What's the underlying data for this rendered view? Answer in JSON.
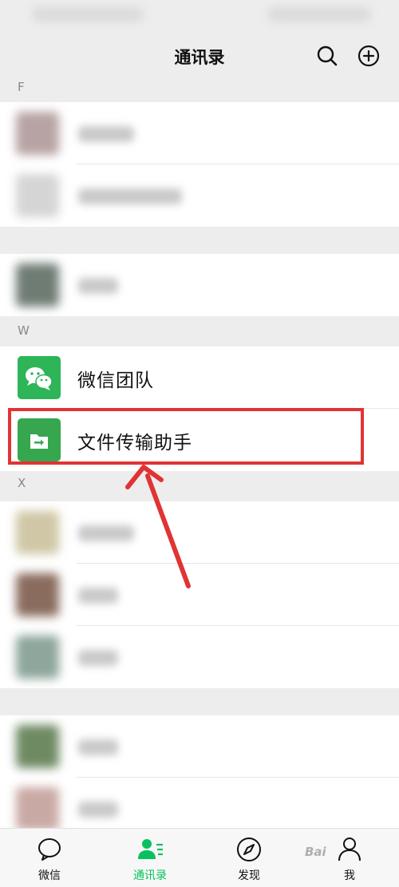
{
  "nav": {
    "title": "通讯录",
    "search_icon": "search-icon",
    "add_icon": "add-circle-icon"
  },
  "sections": {
    "f": "F",
    "w": "W",
    "x": "X"
  },
  "contacts": {
    "wechat_team": {
      "name": "微信团队",
      "icon": "wechat-bubbles-icon"
    },
    "file_transfer": {
      "name": "文件传输助手",
      "icon": "folder-transfer-icon"
    }
  },
  "tabs": [
    {
      "label": "微信",
      "icon": "chat-bubble-icon",
      "active": false
    },
    {
      "label": "通讯录",
      "icon": "contacts-icon",
      "active": true
    },
    {
      "label": "发现",
      "icon": "compass-icon",
      "active": false
    },
    {
      "label": "我",
      "icon": "person-icon",
      "active": false
    }
  ],
  "watermark": "Bai",
  "colors": {
    "accent": "#07c160",
    "highlight": "#e03434",
    "wechat_green": "#2db558"
  }
}
